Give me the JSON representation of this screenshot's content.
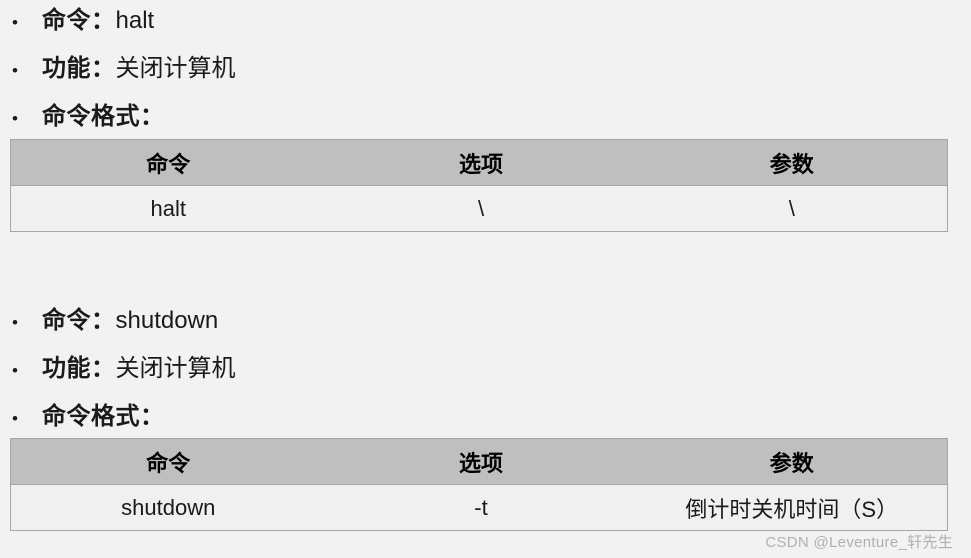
{
  "page": {
    "background_color": "#f2f2f2",
    "text_color": "#1a1a1a"
  },
  "sections": [
    {
      "bullets": [
        {
          "marker": "•",
          "label": "命令：",
          "value": "halt"
        },
        {
          "marker": "•",
          "label": "功能：",
          "value": "关闭计算机"
        },
        {
          "marker": "•",
          "label": "命令格式：",
          "value": ""
        }
      ],
      "table": {
        "header_background": "#bfbfbf",
        "body_background": "#f0f0f0",
        "border_color": "#a6a6a6",
        "columns": [
          "命令",
          "选项",
          "参数"
        ],
        "rows": [
          [
            "halt",
            "\\",
            "\\"
          ]
        ]
      }
    },
    {
      "bullets": [
        {
          "marker": "•",
          "label": "命令：",
          "value": "shutdown"
        },
        {
          "marker": "•",
          "label": "功能：",
          "value": "关闭计算机"
        },
        {
          "marker": "•",
          "label": "命令格式：",
          "value": ""
        }
      ],
      "table": {
        "header_background": "#bfbfbf",
        "body_background": "#f0f0f0",
        "border_color": "#a6a6a6",
        "columns": [
          "命令",
          "选项",
          "参数"
        ],
        "rows": [
          [
            "shutdown",
            "-t",
            "倒计时关机时间（S）"
          ]
        ]
      }
    }
  ],
  "watermark": {
    "text": "CSDN @Leventure_轩先生"
  }
}
